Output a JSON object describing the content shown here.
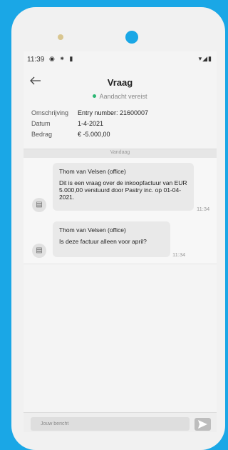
{
  "status_bar": {
    "time": "11:39",
    "notification_icons": "◉ ⁕ ▮",
    "system_icons": "▾◢▮"
  },
  "header": {
    "title": "Vraag",
    "status": "Aandacht vereist",
    "status_color": "#2bb673"
  },
  "details": [
    {
      "label": "Omschrijving",
      "value": "Entry number: 21600007"
    },
    {
      "label": "Datum",
      "value": "1-4-2021"
    },
    {
      "label": "Bedrag",
      "value": "€ -5.000,00"
    }
  ],
  "date_divider": "Vandaag",
  "messages": [
    {
      "sender": "Thom van Velsen (office)",
      "text": "Dit is een vraag over de inkoopfactuur van EUR 5.000,00 verstuurd door Pastry inc. op 01-04-2021.",
      "time": "11:34"
    },
    {
      "sender": "Thom van Velsen (office)",
      "text": "Is deze factuur alleen voor april?",
      "time": "11:34"
    }
  ],
  "composer": {
    "placeholder": "Jouw bericht"
  }
}
